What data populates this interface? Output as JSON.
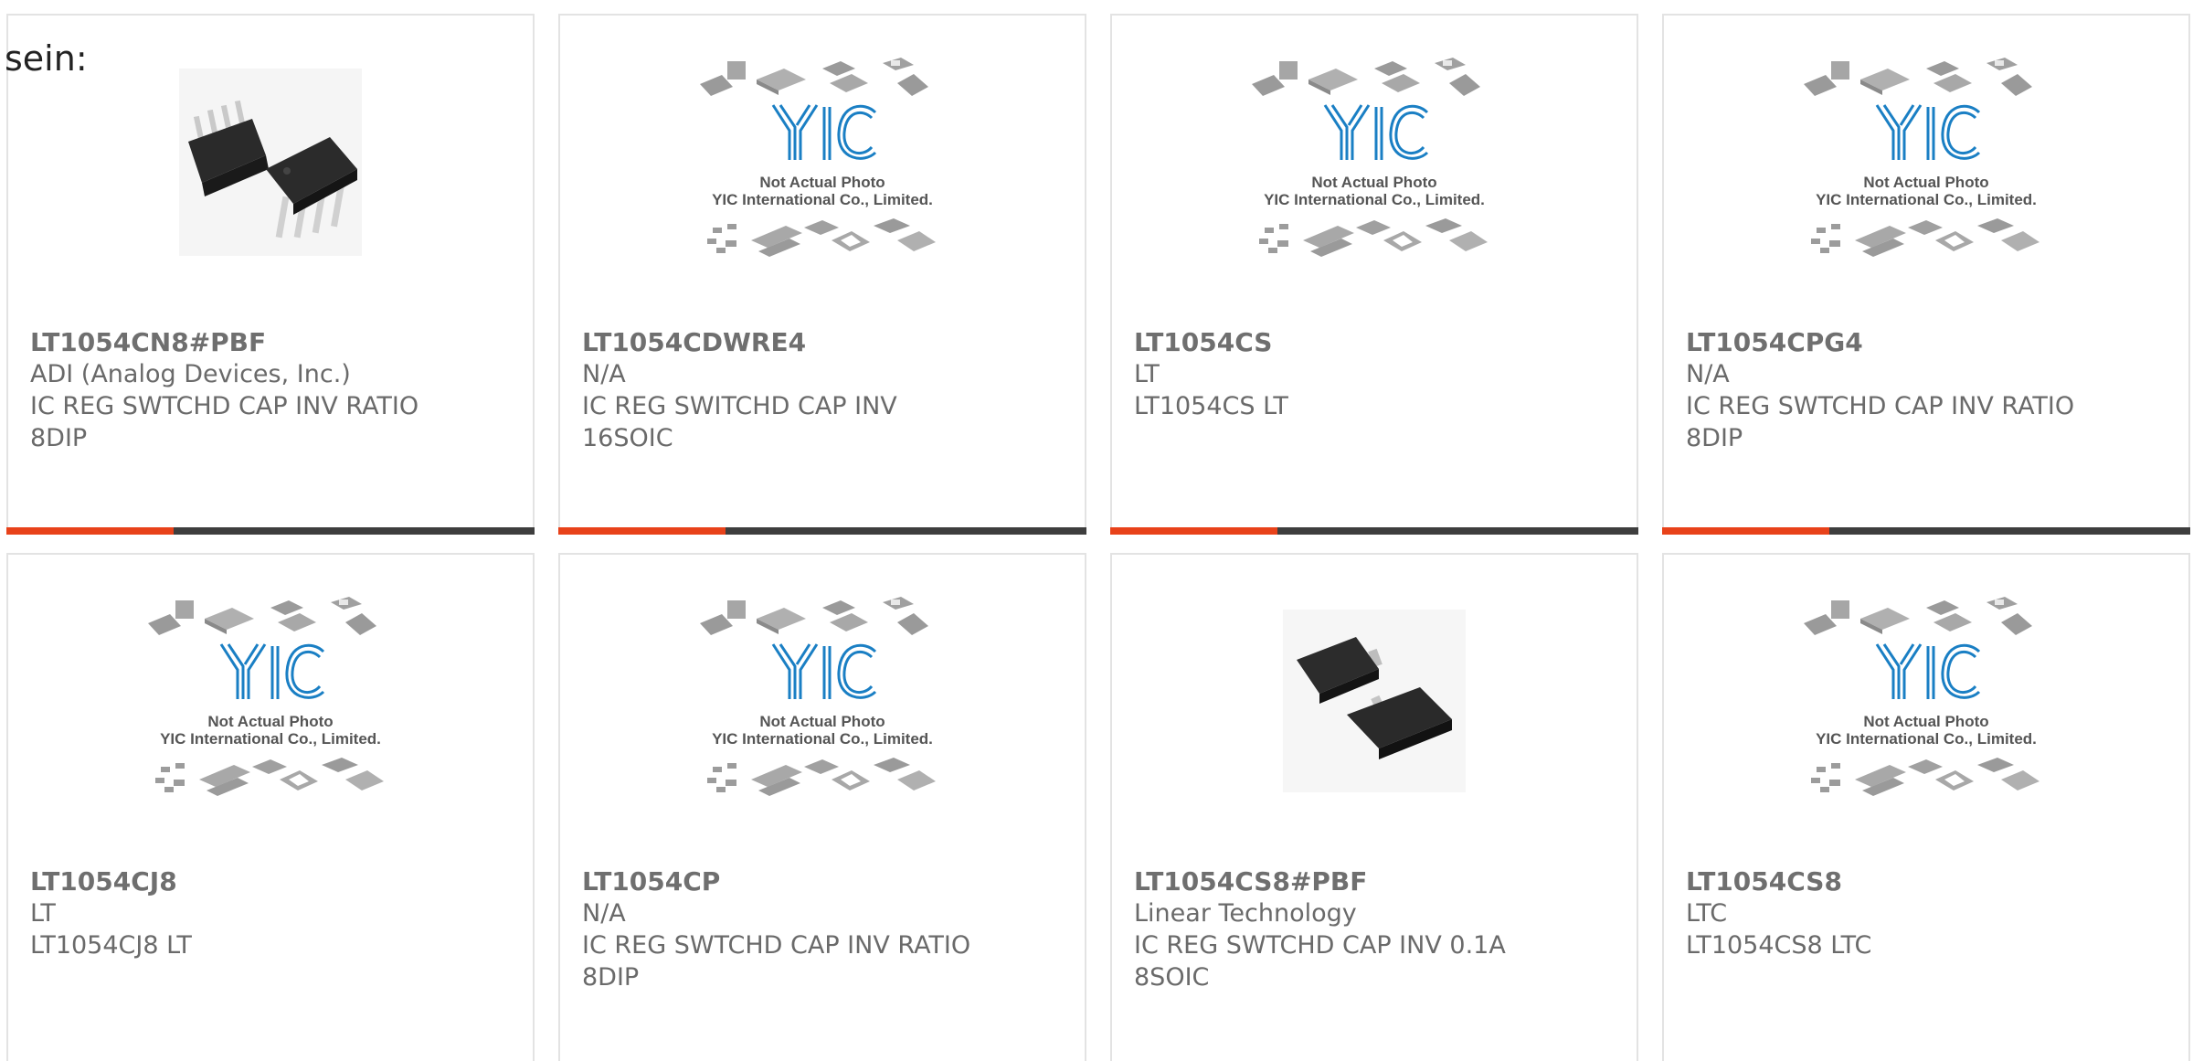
{
  "lead_text": "sein:",
  "colors": {
    "accent": "#e8421a",
    "bar": "#3e3e3e",
    "logo_blue": "#1a7fc4",
    "text": "#6a6a6a"
  },
  "placeholder": {
    "line1": "Not Actual Photo",
    "line2": "YIC International Co., Limited."
  },
  "products": [
    {
      "part": "LT1054CN8#PBF",
      "manufacturer": "ADI (Analog Devices, Inc.)",
      "desc_line1": "IC REG SWTCHD CAP INV RATIO",
      "desc_line2": "8DIP",
      "image": "dip8-photo"
    },
    {
      "part": "LT1054CDWRE4",
      "manufacturer": "N/A",
      "desc_line1": "IC REG SWITCHD CAP INV",
      "desc_line2": "16SOIC",
      "image": "yic-placeholder"
    },
    {
      "part": "LT1054CS",
      "manufacturer": "LT",
      "desc_line1": "LT1054CS LT",
      "desc_line2": "",
      "image": "yic-placeholder"
    },
    {
      "part": "LT1054CPG4",
      "manufacturer": "N/A",
      "desc_line1": "IC REG SWTCHD CAP INV RATIO",
      "desc_line2": "8DIP",
      "image": "yic-placeholder"
    },
    {
      "part": "LT1054CJ8",
      "manufacturer": "LT",
      "desc_line1": "LT1054CJ8 LT",
      "desc_line2": "",
      "image": "yic-placeholder"
    },
    {
      "part": "LT1054CP",
      "manufacturer": "N/A",
      "desc_line1": "IC REG SWTCHD CAP INV RATIO",
      "desc_line2": "8DIP",
      "image": "yic-placeholder"
    },
    {
      "part": "LT1054CS8#PBF",
      "manufacturer": "Linear Technology",
      "desc_line1": "IC REG SWTCHD CAP INV 0.1A",
      "desc_line2": "8SOIC",
      "image": "soic8-photo"
    },
    {
      "part": "LT1054CS8",
      "manufacturer": "LTC",
      "desc_line1": "LT1054CS8 LTC",
      "desc_line2": "",
      "image": "yic-placeholder"
    }
  ]
}
